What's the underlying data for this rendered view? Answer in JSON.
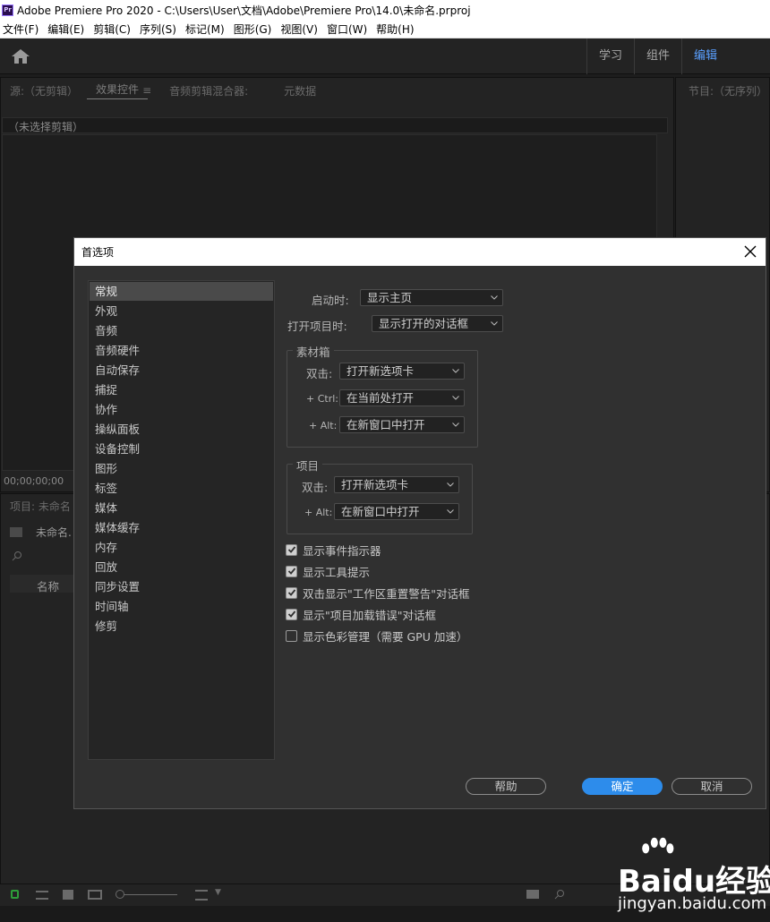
{
  "window": {
    "app_icon": "Pr",
    "title": "Adobe Premiere Pro 2020 - C:\\Users\\User\\文档\\Adobe\\Premiere Pro\\14.0\\未命名.prproj"
  },
  "menu": [
    "文件(F)",
    "编辑(E)",
    "剪辑(C)",
    "序列(S)",
    "标记(M)",
    "图形(G)",
    "视图(V)",
    "窗口(W)",
    "帮助(H)"
  ],
  "workspaces": {
    "tabs": [
      "学习",
      "组件",
      "编辑"
    ],
    "active": "编辑"
  },
  "source_panel": {
    "tabs": [
      "源:（无剪辑）",
      "效果控件",
      "音频剪辑混合器:",
      "元数据"
    ],
    "active_tab": "效果控件",
    "clip_header": "（未选择剪辑）",
    "timecode": "00;00;00;00"
  },
  "program_panel": {
    "tab": "节目:（无序列）"
  },
  "project_panel": {
    "tab": "项目: 未命名",
    "item": "未命名.",
    "column_name": "名称"
  },
  "dialog": {
    "title": "首选项",
    "sidebar": [
      "常规",
      "外观",
      "音频",
      "音频硬件",
      "自动保存",
      "捕捉",
      "协作",
      "操纵面板",
      "设备控制",
      "图形",
      "标签",
      "媒体",
      "媒体缓存",
      "内存",
      "回放",
      "同步设置",
      "时间轴",
      "修剪"
    ],
    "selected": "常规",
    "startup_label": "启动时:",
    "startup_value": "显示主页",
    "open_project_label": "打开项目时:",
    "open_project_value": "显示打开的对话框",
    "bins": {
      "legend": "素材箱",
      "double_click_label": "双击:",
      "double_click_value": "打开新选项卡",
      "ctrl_label": "+ Ctrl:",
      "ctrl_value": "在当前处打开",
      "alt_label": "+ Alt:",
      "alt_value": "在新窗口中打开"
    },
    "projects": {
      "legend": "项目",
      "double_click_label": "双击:",
      "double_click_value": "打开新选项卡",
      "alt_label": "+ Alt:",
      "alt_value": "在新窗口中打开"
    },
    "checkboxes": [
      {
        "label": "显示事件指示器",
        "checked": true
      },
      {
        "label": "显示工具提示",
        "checked": true
      },
      {
        "label": "双击显示\"工作区重置警告\"对话框",
        "checked": true
      },
      {
        "label": "显示\"项目加载错误\"对话框",
        "checked": true
      },
      {
        "label": "显示色彩管理（需要 GPU 加速）",
        "checked": false
      }
    ],
    "buttons": {
      "help": "帮助",
      "ok": "确定",
      "cancel": "取消"
    }
  },
  "watermark": {
    "text": "Baidu经验",
    "url": "jingyan.baidu.com"
  }
}
